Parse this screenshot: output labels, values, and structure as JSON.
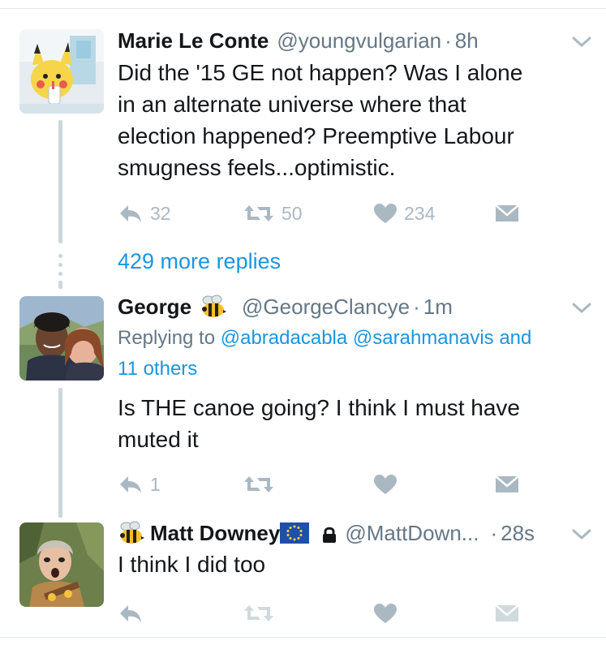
{
  "tweets": [
    {
      "name": "Marie Le Conte",
      "handle": "@youngvulgarian",
      "separator": "·",
      "time": "8h",
      "text_lines": [
        "Did the '15 GE not happen? Was I alone",
        "in an alternate universe where that",
        "election happened? Preemptive Labour",
        "smugness feels...optimistic."
      ],
      "reply_count": "32",
      "retweet_count": "50",
      "like_count": "234"
    },
    {
      "name": "George",
      "handle": "@GeorgeClancye",
      "separator": "·",
      "time": "1m",
      "replying_prefix": "Replying to",
      "replying_mention_1": "@abradacabla",
      "replying_mention_2": "@sarahmanavis",
      "replying_and": "and",
      "replying_others": "11 others",
      "text_lines": [
        "Is THE canoe going? I think I must have",
        "muted it"
      ],
      "reply_count": "1"
    },
    {
      "name": "Matt Downey",
      "handle": "@MattDown...",
      "separator": "·",
      "time": "28s",
      "text_lines": [
        "I think I did too"
      ]
    }
  ],
  "more_replies": "429 more replies",
  "icons": {
    "reply": "reply-icon",
    "retweet": "retweet-icon",
    "like": "heart-icon",
    "dm": "envelope-icon",
    "menu": "chevron-down-icon",
    "bee": "bee-emoji-icon",
    "eu_flag": "eu-flag-icon",
    "lock": "lock-icon"
  },
  "colors": {
    "link": "#1b95e0",
    "muted_text": "#657786",
    "action_gray": "#aab8c2",
    "thread_line": "#ccd6dd"
  }
}
